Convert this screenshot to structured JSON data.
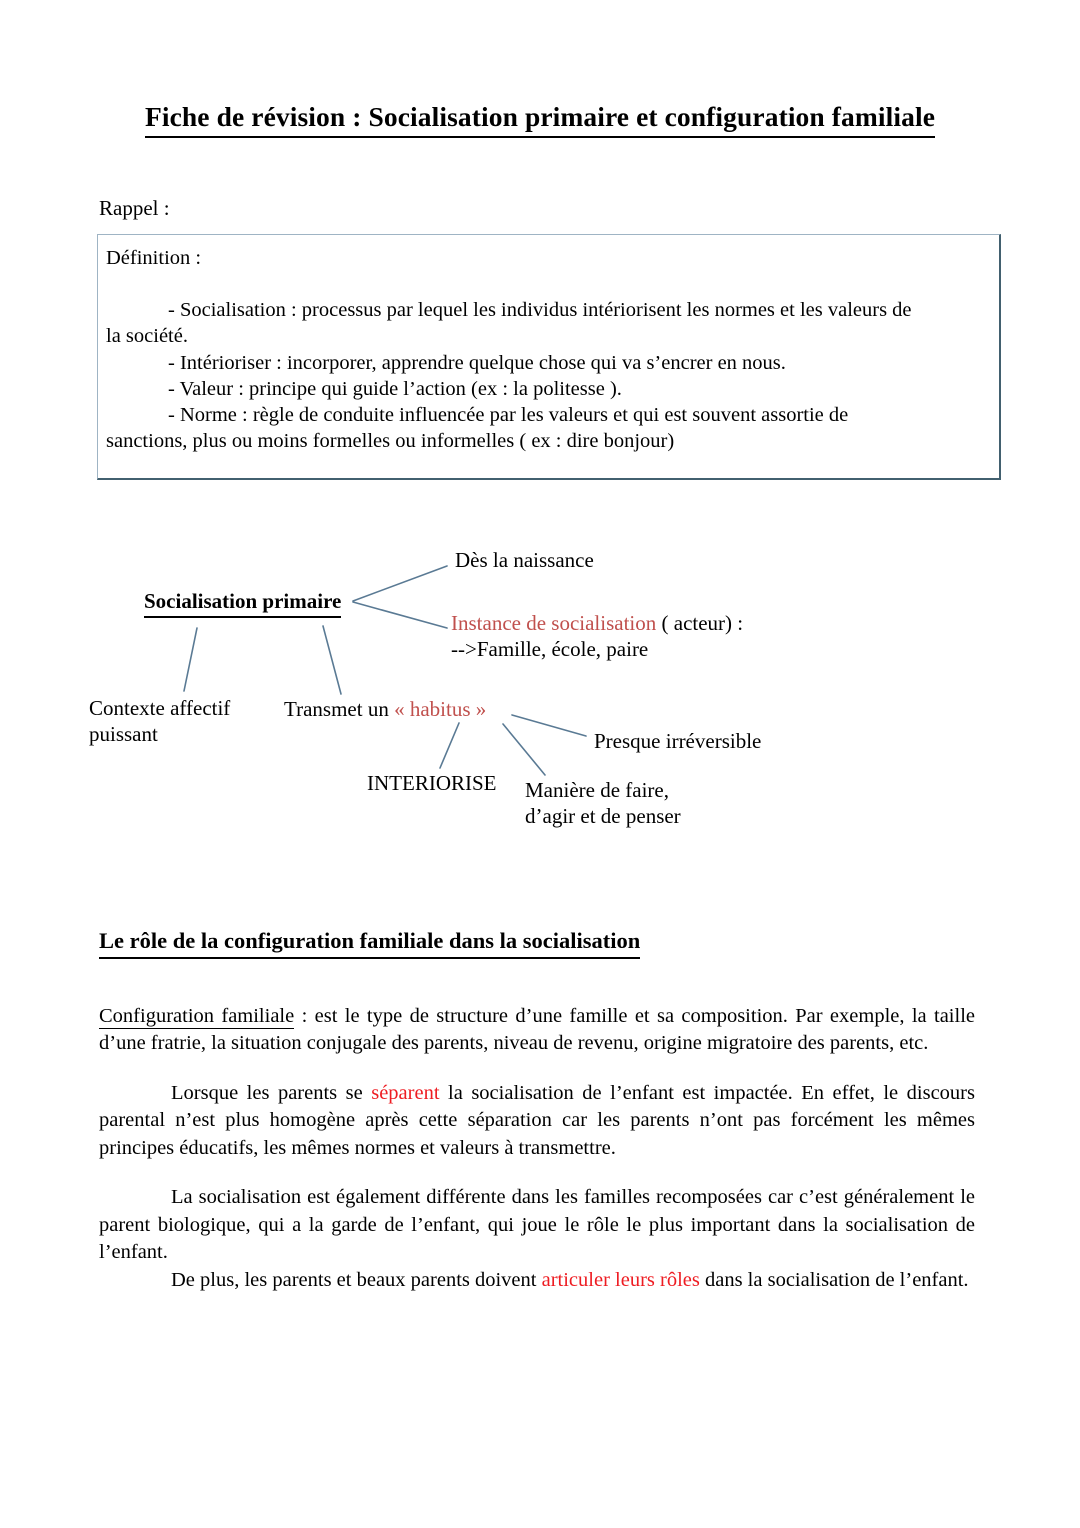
{
  "document": {
    "title": "Fiche de révision : Socialisation primaire et configuration familiale",
    "rappel_label": "Rappel :"
  },
  "definition_box": {
    "heading": "Définition :",
    "items": [
      "- Socialisation : processus par lequel les individus intériorisent les normes et les valeurs de",
      "la société.",
      "- Intérioriser : incorporer, apprendre quelque chose qui va s’encrer en nous.",
      "- Valeur : principe qui guide l’action (ex : la politesse ).",
      "- Norme : règle de conduite influencée par les valeurs et qui est souvent assortie de",
      "sanctions, plus ou moins formelles ou informelles ( ex : dire bonjour)"
    ]
  },
  "mindmap": {
    "center": "Socialisation primaire",
    "nodes": {
      "naissance": "Dès la naissance",
      "instance_red": "Instance de socialisation",
      "instance_rest": " ( acteur) :",
      "instance_line2": "-->Famille, école, paire",
      "contexte_line1": "Contexte affectif",
      "contexte_line2": "puissant",
      "transmet_prefix": "Transmet un ",
      "transmet_red": "« habitus »",
      "presque": "Presque irréversible",
      "interiorise": "INTERIORISE",
      "maniere_line1": "Manière de faire,",
      "maniere_line2": "d’agir et de penser"
    },
    "colors": {
      "connector": "#5a7a94",
      "accent_red_soft": "#c0504d",
      "accent_red_hot": "#ee1c22"
    }
  },
  "section": {
    "heading": "Le rôle de la configuration familiale dans la socialisation"
  },
  "paragraphs": {
    "p1_term": "Configuration familiale",
    "p1_rest": " : est le type de structure d’une famille et sa composition. Par exemple, la taille d’une fratrie, la situation conjugale des parents, niveau de revenu, origine migratoire des parents, etc.",
    "p2_a": "Lorsque les parents se ",
    "p2_red": "séparent",
    "p2_b": " la socialisation de l’enfant est impactée. En effet, le discours parental n’est plus homogène après cette séparation car les parents n’ont pas forcément les mêmes principes éducatifs, les mêmes normes et valeurs à transmettre.",
    "p3": "La socialisation est également différente dans les familles recomposées car c’est généralement le parent biologique, qui a la garde de l’enfant, qui joue le rôle le plus important dans la socialisation de l’enfant.",
    "p4_a": "De plus, les parents et beaux parents doivent ",
    "p4_red": "articuler leurs rôles",
    "p4_b": " dans la socialisation de l’enfant."
  }
}
